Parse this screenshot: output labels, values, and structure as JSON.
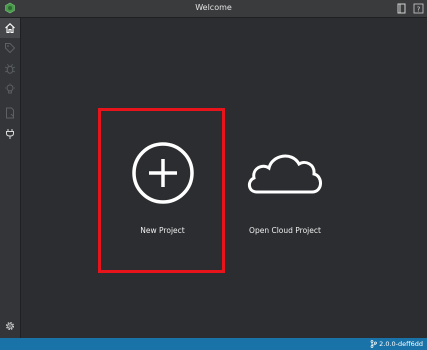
{
  "window": {
    "title": "Welcome"
  },
  "sidebar": {
    "items": [
      {
        "icon": "home-icon",
        "state": "active"
      },
      {
        "icon": "tag-icon",
        "state": "disabled"
      },
      {
        "icon": "bug-icon",
        "state": "disabled"
      },
      {
        "icon": "lightbulb-icon",
        "state": "disabled"
      },
      {
        "icon": "document-icon",
        "state": "disabled"
      },
      {
        "icon": "plug-icon",
        "state": "enabled"
      }
    ],
    "bottom_icon": "gear-icon"
  },
  "main": {
    "cards": [
      {
        "label": "New Project",
        "icon": "plus-circle-icon"
      },
      {
        "label": "Open Cloud Project",
        "icon": "cloud-icon"
      }
    ]
  },
  "statusbar": {
    "version": "2.0.0-deff6dd"
  },
  "colors": {
    "accent": "#1a73a8",
    "highlight": "#e8141b",
    "background": "#2b2d30"
  }
}
